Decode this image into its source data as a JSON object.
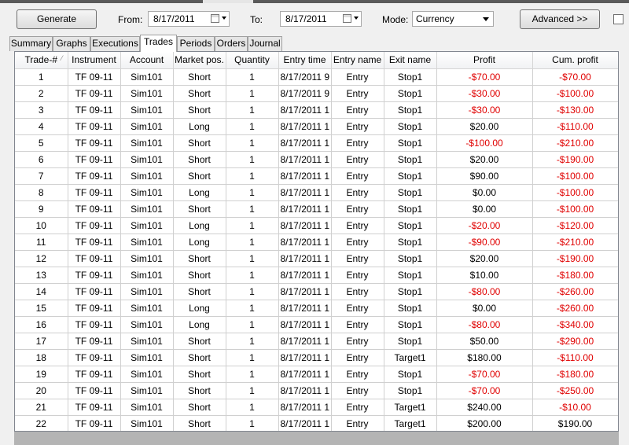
{
  "toolbar": {
    "generate_label": "Generate",
    "from_label": "From:",
    "from_value": "8/17/2011",
    "to_label": "To:",
    "to_value": "8/17/2011",
    "mode_label": "Mode:",
    "mode_value": "Currency",
    "advanced_label": "Advanced >>"
  },
  "tabs": [
    "Summary",
    "Graphs",
    "Executions",
    "Trades",
    "Periods",
    "Orders",
    "Journal"
  ],
  "active_tab": "Trades",
  "colors": {
    "negative": "#e00000"
  },
  "table": {
    "columns": [
      "Trade-#",
      "Instrument",
      "Account",
      "Market pos.",
      "Quantity",
      "Entry time",
      "Entry name",
      "Exit name",
      "Profit",
      "Cum. profit"
    ],
    "rows": [
      [
        "1",
        "TF 09-11",
        "Sim101",
        "Short",
        "1",
        "8/17/2011 9",
        "Entry",
        "Stop1",
        "-$70.00",
        "-$70.00"
      ],
      [
        "2",
        "TF 09-11",
        "Sim101",
        "Short",
        "1",
        "8/17/2011 9",
        "Entry",
        "Stop1",
        "-$30.00",
        "-$100.00"
      ],
      [
        "3",
        "TF 09-11",
        "Sim101",
        "Short",
        "1",
        "8/17/2011 1",
        "Entry",
        "Stop1",
        "-$30.00",
        "-$130.00"
      ],
      [
        "4",
        "TF 09-11",
        "Sim101",
        "Long",
        "1",
        "8/17/2011 1",
        "Entry",
        "Stop1",
        "$20.00",
        "-$110.00"
      ],
      [
        "5",
        "TF 09-11",
        "Sim101",
        "Short",
        "1",
        "8/17/2011 1",
        "Entry",
        "Stop1",
        "-$100.00",
        "-$210.00"
      ],
      [
        "6",
        "TF 09-11",
        "Sim101",
        "Short",
        "1",
        "8/17/2011 1",
        "Entry",
        "Stop1",
        "$20.00",
        "-$190.00"
      ],
      [
        "7",
        "TF 09-11",
        "Sim101",
        "Short",
        "1",
        "8/17/2011 1",
        "Entry",
        "Stop1",
        "$90.00",
        "-$100.00"
      ],
      [
        "8",
        "TF 09-11",
        "Sim101",
        "Long",
        "1",
        "8/17/2011 1",
        "Entry",
        "Stop1",
        "$0.00",
        "-$100.00"
      ],
      [
        "9",
        "TF 09-11",
        "Sim101",
        "Short",
        "1",
        "8/17/2011 1",
        "Entry",
        "Stop1",
        "$0.00",
        "-$100.00"
      ],
      [
        "10",
        "TF 09-11",
        "Sim101",
        "Long",
        "1",
        "8/17/2011 1",
        "Entry",
        "Stop1",
        "-$20.00",
        "-$120.00"
      ],
      [
        "11",
        "TF 09-11",
        "Sim101",
        "Long",
        "1",
        "8/17/2011 1",
        "Entry",
        "Stop1",
        "-$90.00",
        "-$210.00"
      ],
      [
        "12",
        "TF 09-11",
        "Sim101",
        "Short",
        "1",
        "8/17/2011 1",
        "Entry",
        "Stop1",
        "$20.00",
        "-$190.00"
      ],
      [
        "13",
        "TF 09-11",
        "Sim101",
        "Short",
        "1",
        "8/17/2011 1",
        "Entry",
        "Stop1",
        "$10.00",
        "-$180.00"
      ],
      [
        "14",
        "TF 09-11",
        "Sim101",
        "Short",
        "1",
        "8/17/2011 1",
        "Entry",
        "Stop1",
        "-$80.00",
        "-$260.00"
      ],
      [
        "15",
        "TF 09-11",
        "Sim101",
        "Long",
        "1",
        "8/17/2011 1",
        "Entry",
        "Stop1",
        "$0.00",
        "-$260.00"
      ],
      [
        "16",
        "TF 09-11",
        "Sim101",
        "Long",
        "1",
        "8/17/2011 1",
        "Entry",
        "Stop1",
        "-$80.00",
        "-$340.00"
      ],
      [
        "17",
        "TF 09-11",
        "Sim101",
        "Short",
        "1",
        "8/17/2011 1",
        "Entry",
        "Stop1",
        "$50.00",
        "-$290.00"
      ],
      [
        "18",
        "TF 09-11",
        "Sim101",
        "Short",
        "1",
        "8/17/2011 1",
        "Entry",
        "Target1",
        "$180.00",
        "-$110.00"
      ],
      [
        "19",
        "TF 09-11",
        "Sim101",
        "Short",
        "1",
        "8/17/2011 1",
        "Entry",
        "Stop1",
        "-$70.00",
        "-$180.00"
      ],
      [
        "20",
        "TF 09-11",
        "Sim101",
        "Short",
        "1",
        "8/17/2011 1",
        "Entry",
        "Stop1",
        "-$70.00",
        "-$250.00"
      ],
      [
        "21",
        "TF 09-11",
        "Sim101",
        "Short",
        "1",
        "8/17/2011 1",
        "Entry",
        "Target1",
        "$240.00",
        "-$10.00"
      ],
      [
        "22",
        "TF 09-11",
        "Sim101",
        "Short",
        "1",
        "8/17/2011 1",
        "Entry",
        "Target1",
        "$200.00",
        "$190.00"
      ]
    ]
  }
}
